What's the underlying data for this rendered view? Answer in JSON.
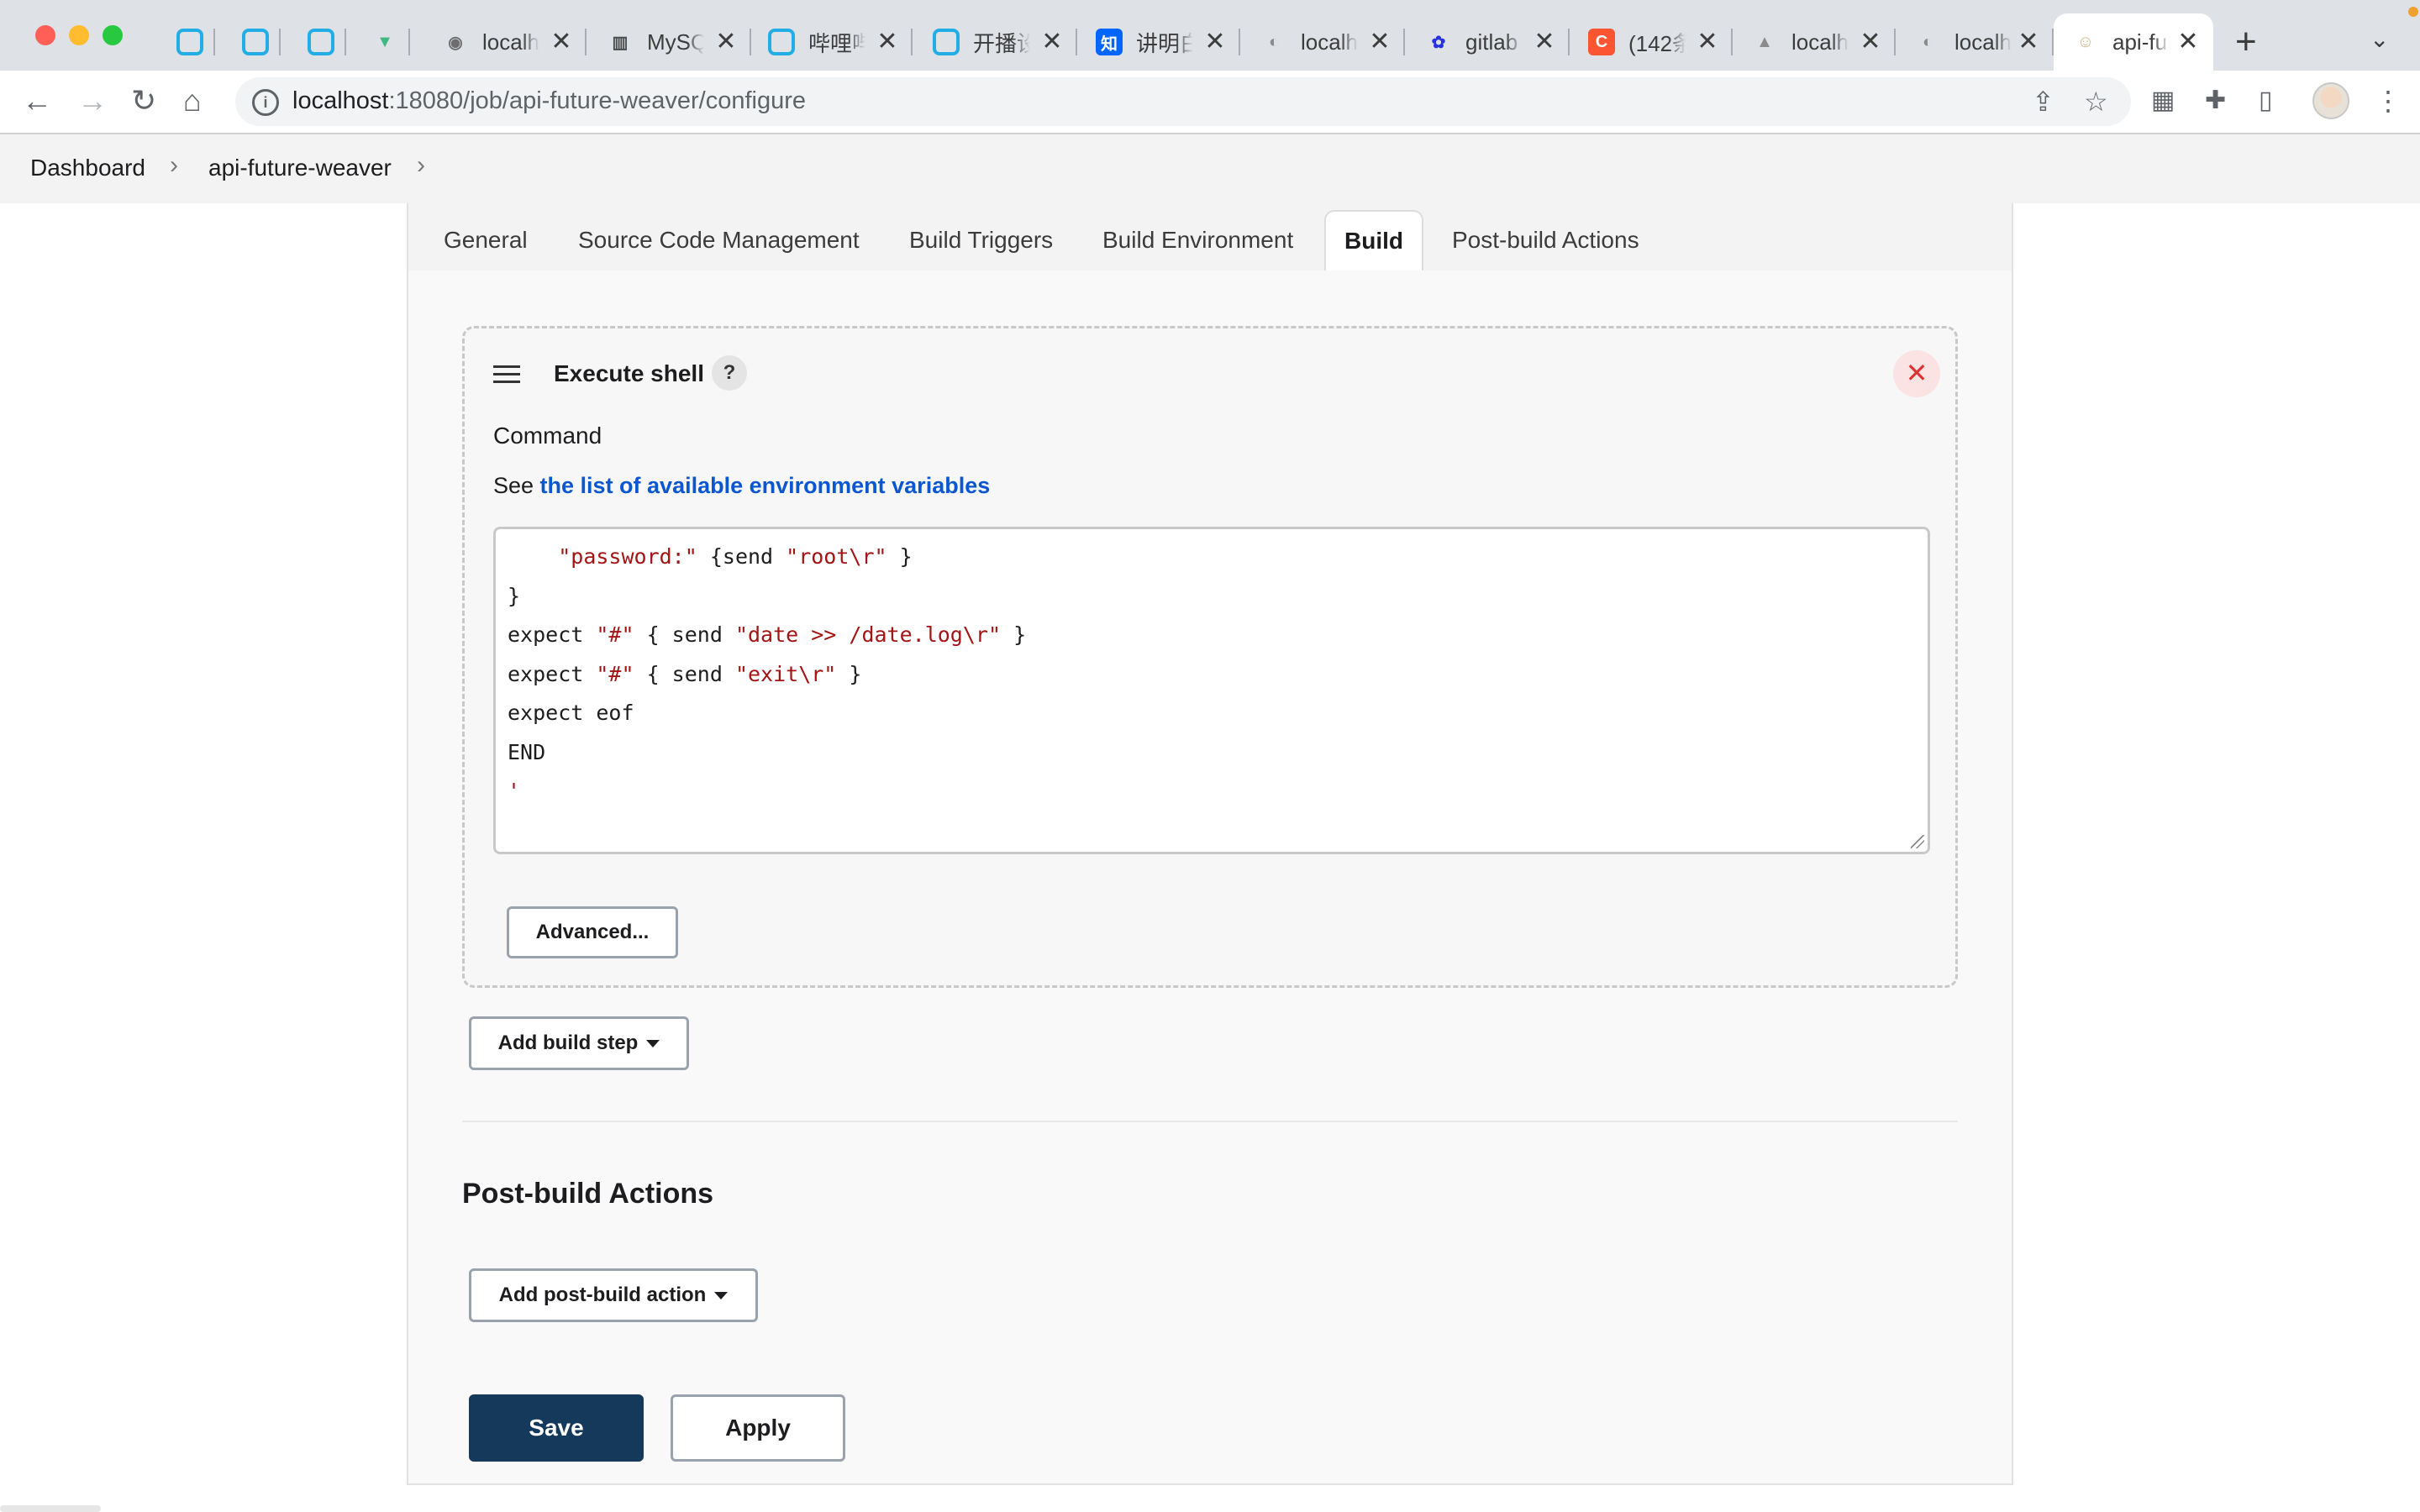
{
  "browser": {
    "tabs": [
      {
        "title": "",
        "icon": "bilibili-tv-icon",
        "close": ""
      },
      {
        "title": "",
        "icon": "bilibili-tv-icon",
        "close": ""
      },
      {
        "title": "",
        "icon": "bilibili-tv-icon",
        "close": ""
      },
      {
        "title": "",
        "icon": "vue-logo-icon",
        "close": ""
      },
      {
        "title": "localh",
        "icon": "octocat-icon",
        "close": "✕"
      },
      {
        "title": "MySQ",
        "icon": "book-icon",
        "close": "✕"
      },
      {
        "title": "哔哩哔",
        "icon": "bilibili-tv-icon",
        "close": "✕"
      },
      {
        "title": "开播设",
        "icon": "bilibili-tv-icon",
        "close": "✕"
      },
      {
        "title": "讲明白",
        "icon": "zhihu-icon",
        "close": "✕"
      },
      {
        "title": "localh",
        "icon": "gitlab-icon",
        "close": "✕"
      },
      {
        "title": "gitlab",
        "icon": "baidu-paw-icon",
        "close": "✕"
      },
      {
        "title": "(142条",
        "icon": "csdn-icon",
        "close": "✕"
      },
      {
        "title": "localh",
        "icon": "gitlab-fox-icon",
        "close": "✕"
      },
      {
        "title": "localh",
        "icon": "gitlab-icon",
        "close": "✕"
      },
      {
        "title": "api-fu",
        "icon": "jenkins-icon",
        "close": "✕"
      }
    ],
    "new_tab": "+",
    "tab_menu": "⌄",
    "url_host": "localhost",
    "url_rest": ":18080/job/api-future-weaver/configure"
  },
  "breadcrumb": {
    "items": [
      "Dashboard",
      "api-future-weaver"
    ],
    "separator": "›"
  },
  "config_tabs": [
    "General",
    "Source Code Management",
    "Build Triggers",
    "Build Environment",
    "Build",
    "Post-build Actions"
  ],
  "active_tab": "Build",
  "build_step": {
    "title": "Execute shell",
    "help": "?",
    "close": "✕",
    "command_label": "Command",
    "env_prefix": "See ",
    "env_link": "the list of available environment variables",
    "code": [
      {
        "indent": "    ",
        "parts": [
          [
            "str",
            "\"password:\""
          ],
          [
            "plain",
            " {send "
          ],
          [
            "str",
            "\"root\\r\""
          ],
          [
            "plain",
            " }"
          ]
        ]
      },
      {
        "indent": "",
        "parts": [
          [
            "plain",
            "}"
          ]
        ]
      },
      {
        "indent": "",
        "parts": [
          [
            "plain",
            "expect "
          ],
          [
            "str",
            "\"#\""
          ],
          [
            "plain",
            " { send "
          ],
          [
            "str",
            "\"date >> /date.log\\r\""
          ],
          [
            "plain",
            " }"
          ]
        ]
      },
      {
        "indent": "",
        "parts": [
          [
            "plain",
            "expect "
          ],
          [
            "str",
            "\"#\""
          ],
          [
            "plain",
            " { send "
          ],
          [
            "str",
            "\"exit\\r\""
          ],
          [
            "plain",
            " }"
          ]
        ]
      },
      {
        "indent": "",
        "parts": [
          [
            "plain",
            "expect eof"
          ]
        ]
      },
      {
        "indent": "",
        "parts": [
          [
            "plain",
            "END"
          ]
        ]
      },
      {
        "indent": "",
        "parts": [
          [
            "str",
            "'"
          ]
        ]
      }
    ],
    "advanced_label": "Advanced..."
  },
  "add_build_step_label": "Add build step",
  "post_build": {
    "title": "Post-build Actions",
    "add_label": "Add post-build action"
  },
  "actions": {
    "save_label": "Save",
    "apply_label": "Apply"
  },
  "colors": {
    "save_bg": "#14395b",
    "link": "#0b57d0",
    "string": "#a31515",
    "close_red": "#dd3333"
  }
}
